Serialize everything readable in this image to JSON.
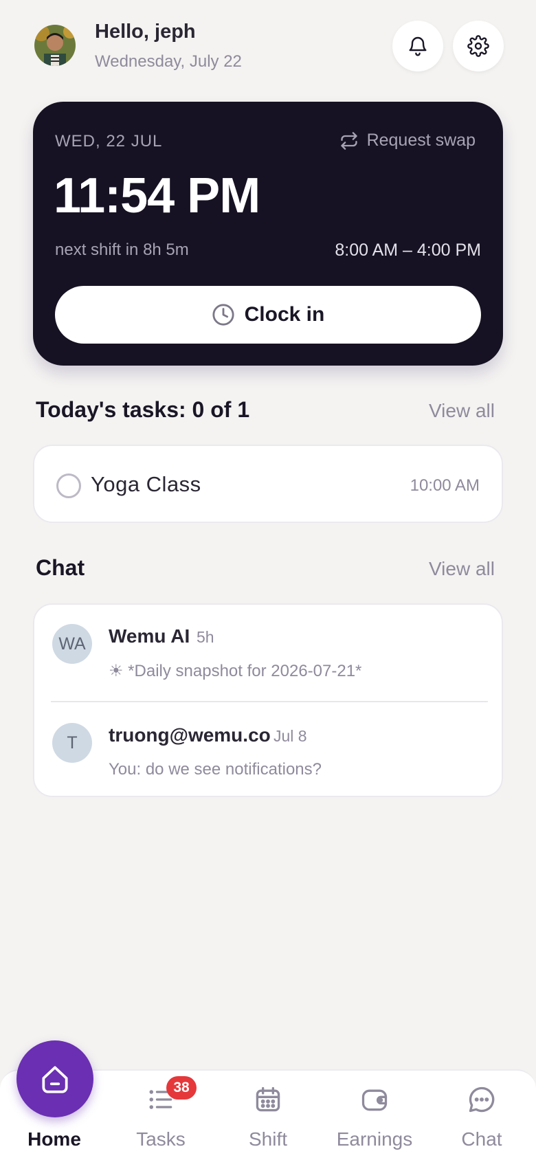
{
  "header": {
    "greeting": "Hello, jeph",
    "date": "Wednesday, July 22"
  },
  "shift_card": {
    "date": "WED, 22 JUL",
    "request_swap_label": "Request swap",
    "current_time": "11:54 PM",
    "next_shift": "next shift in 8h 5m",
    "shift_range": "8:00 AM – 4:00 PM",
    "clock_in_label": "Clock in"
  },
  "tasks": {
    "title": "Today's tasks: 0 of 1",
    "view_all": "View all",
    "items": [
      {
        "name": "Yoga Class",
        "time": "10:00 AM",
        "done": false
      }
    ]
  },
  "chat": {
    "title": "Chat",
    "view_all": "View all",
    "items": [
      {
        "initials": "WA",
        "name": "Wemu AI",
        "when": "5h",
        "message": "☀ *Daily snapshot for 2026-07-21*"
      },
      {
        "initials": "T",
        "name": "truong@wemu.co",
        "when": "Jul 8",
        "message": "You: do we see notifications?"
      }
    ]
  },
  "bottom_nav": {
    "items": [
      {
        "label": "Home",
        "icon": "home-icon",
        "active": true
      },
      {
        "label": "Tasks",
        "icon": "tasks-icon",
        "badge": "38"
      },
      {
        "label": "Shift",
        "icon": "calendar-icon"
      },
      {
        "label": "Earnings",
        "icon": "wallet-icon"
      },
      {
        "label": "Chat",
        "icon": "chat-bubble-icon"
      }
    ]
  },
  "colors": {
    "background": "#f4f3f1",
    "card_dark": "#171223",
    "accent_purple": "#6a2fb2",
    "badge_red": "#e5383b",
    "muted_text": "#8f8a9c"
  }
}
